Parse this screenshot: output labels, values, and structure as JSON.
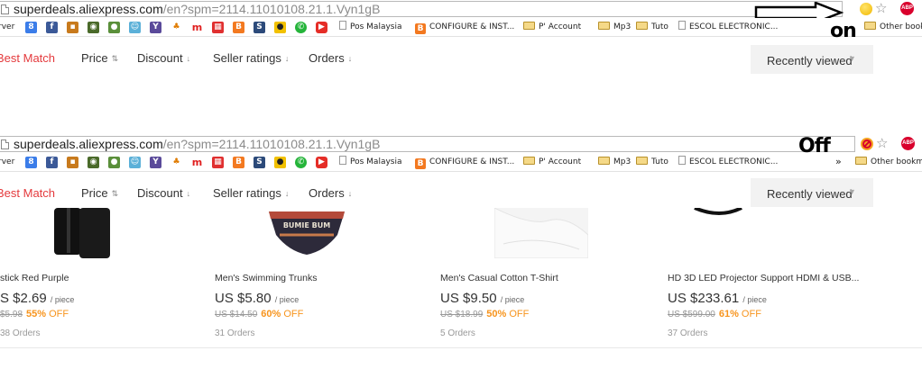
{
  "on_panel": {
    "url_host": "superdeals.aliexpress.com",
    "url_path": "/en?spm=2114.11010108.21.1.Vyn1gB",
    "annotation": "on",
    "bookmarks": {
      "server_fragment": "rver",
      "pos_malaysia": "Pos Malaysia",
      "configure": "CONFIGURE & INST...",
      "p_account": "P' Account",
      "mp3": "Mp3",
      "tuto": "Tuto",
      "escol": "ESCOL ELECTRONIC...",
      "other": "Other book"
    },
    "sort": {
      "best_match": "Best Match",
      "price": "Price",
      "discount": "Discount",
      "seller_ratings": "Seller ratings",
      "orders": "Orders",
      "recently_viewed": "Recently viewed"
    }
  },
  "off_panel": {
    "url_host": "superdeals.aliexpress.com",
    "url_path": "/en?spm=2114.11010108.21.1.Vyn1gB",
    "annotation": "Off",
    "bookmarks": {
      "server_fragment": "rver",
      "pos_malaysia": "Pos Malaysia",
      "configure": "CONFIGURE & INST...",
      "p_account": "P' Account",
      "mp3": "Mp3",
      "tuto": "Tuto",
      "escol": "ESCOL ELECTRONIC...",
      "overflow": "»",
      "other": "Other bookm"
    },
    "sort": {
      "best_match": "Best Match",
      "price": "Price",
      "discount": "Discount",
      "seller_ratings": "Seller ratings",
      "orders": "Orders",
      "recently_viewed": "Recently viewed"
    },
    "products": [
      {
        "title": "stick Red Purple",
        "price": "S $2.69",
        "unit": "/ piece",
        "old_price": "$5.98",
        "discount": "55%",
        "off": "OFF",
        "orders": "38 Orders"
      },
      {
        "title": "Men's Swimming Trunks",
        "price": "US $5.80",
        "unit": "/ piece",
        "old_price": "US $14.50",
        "discount": "60%",
        "off": "OFF",
        "orders": "31 Orders"
      },
      {
        "title": "Men's Casual Cotton T-Shirt",
        "price": "US $9.50",
        "unit": "/ piece",
        "old_price": "US $18.99",
        "discount": "50%",
        "off": "OFF",
        "orders": "5 Orders"
      },
      {
        "title": "HD 3D LED Projector Support HDMI & USB...",
        "price": "US $233.61",
        "unit": "/ piece",
        "old_price": "US $599.00",
        "discount": "61%",
        "off": "OFF",
        "orders": "37 Orders"
      }
    ]
  },
  "icons": {
    "extension_on": "extension-enabled-icon",
    "extension_off": "extension-disabled-icon",
    "bookmark_star": "star-icon",
    "adblock": "adblock-plus-icon",
    "arrow": "right-arrow-annotation"
  },
  "colors": {
    "active_sort": "#e4393c",
    "discount": "#f7941d",
    "extension_on": "#f2b800",
    "adblock": "#d9002c"
  }
}
